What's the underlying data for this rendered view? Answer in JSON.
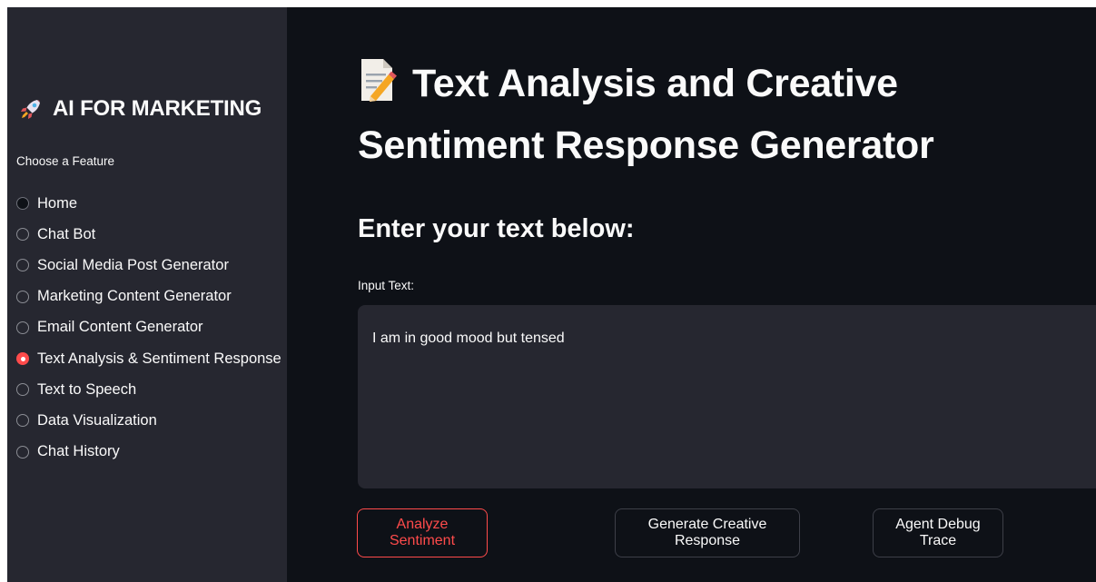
{
  "sidebar": {
    "title": "AI FOR MARKETING",
    "choose_label": "Choose a Feature",
    "options": [
      {
        "label": "Home",
        "state": "home"
      },
      {
        "label": "Chat Bot",
        "state": "unselected"
      },
      {
        "label": "Social Media Post Generator",
        "state": "unselected"
      },
      {
        "label": "Marketing Content Generator",
        "state": "unselected"
      },
      {
        "label": "Email Content Generator",
        "state": "unselected"
      },
      {
        "label": "Text Analysis & Sentiment Response",
        "state": "selected"
      },
      {
        "label": "Text to Speech",
        "state": "unselected"
      },
      {
        "label": "Data Visualization",
        "state": "unselected"
      },
      {
        "label": "Chat History",
        "state": "unselected"
      }
    ]
  },
  "main": {
    "title": "Text Analysis and Creative Sentiment Response Generator",
    "subheader": "Enter your text below:",
    "input_label": "Input Text:",
    "input_value": "I am in good mood but tensed",
    "buttons": {
      "analyze": "Analyze Sentiment",
      "creative": "Generate Creative Response",
      "debug": "Agent Debug Trace"
    }
  },
  "icons": {
    "title_icon": "rocket-icon",
    "page_icon": "memo-icon"
  },
  "colors": {
    "sidebar_bg": "#262730",
    "main_bg": "#0e1117",
    "accent": "#ff4b4b",
    "text": "#fafafa"
  }
}
